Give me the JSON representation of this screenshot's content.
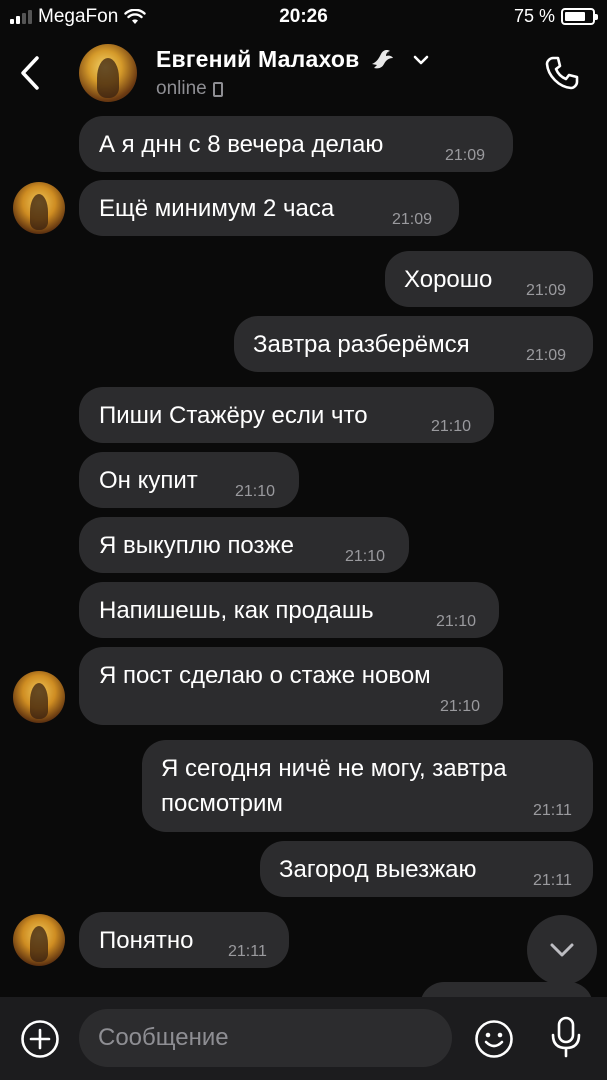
{
  "status_bar": {
    "carrier": "MegaFon",
    "time": "20:26",
    "battery": "75 %",
    "battery_level": 0.75
  },
  "header": {
    "contact_name": "Евгений Малахов",
    "status": "online"
  },
  "messages": [
    {
      "dir": "in",
      "text": "А я днн с 8 вечера делаю",
      "time": "21:09"
    },
    {
      "dir": "in",
      "text": "Ещё минимум 2 часа",
      "time": "21:09"
    },
    {
      "dir": "out",
      "text": "Хорошо",
      "time": "21:09"
    },
    {
      "dir": "out",
      "text": "Завтра разберёмся",
      "time": "21:09"
    },
    {
      "dir": "in",
      "text": "Пиши Стажёру если что",
      "time": "21:10"
    },
    {
      "dir": "in",
      "text": "Он купит",
      "time": "21:10"
    },
    {
      "dir": "in",
      "text": "Я выкуплю позже",
      "time": "21:10"
    },
    {
      "dir": "in",
      "text": "Напишешь, как продашь",
      "time": "21:10"
    },
    {
      "dir": "in",
      "text": "Я пост сделаю о стаже новом",
      "time": "21:10"
    },
    {
      "dir": "out",
      "text": "Я сегодня ничё не могу, завтра",
      "text2": "посмотрим",
      "time": "21:11"
    },
    {
      "dir": "out",
      "text": "Загород выезжаю",
      "time": "21:11"
    },
    {
      "dir": "in",
      "text": "Понятно",
      "time": "21:11"
    }
  ],
  "composer": {
    "placeholder": "Сообщение"
  },
  "icons": {
    "back": "chevron-left-icon",
    "dove": "dove-icon",
    "expand": "chevron-down-icon",
    "call": "phone-icon",
    "add": "plus-circle-icon",
    "emoji": "smile-icon",
    "mic": "microphone-icon",
    "scroll_down": "chevron-down-icon"
  }
}
